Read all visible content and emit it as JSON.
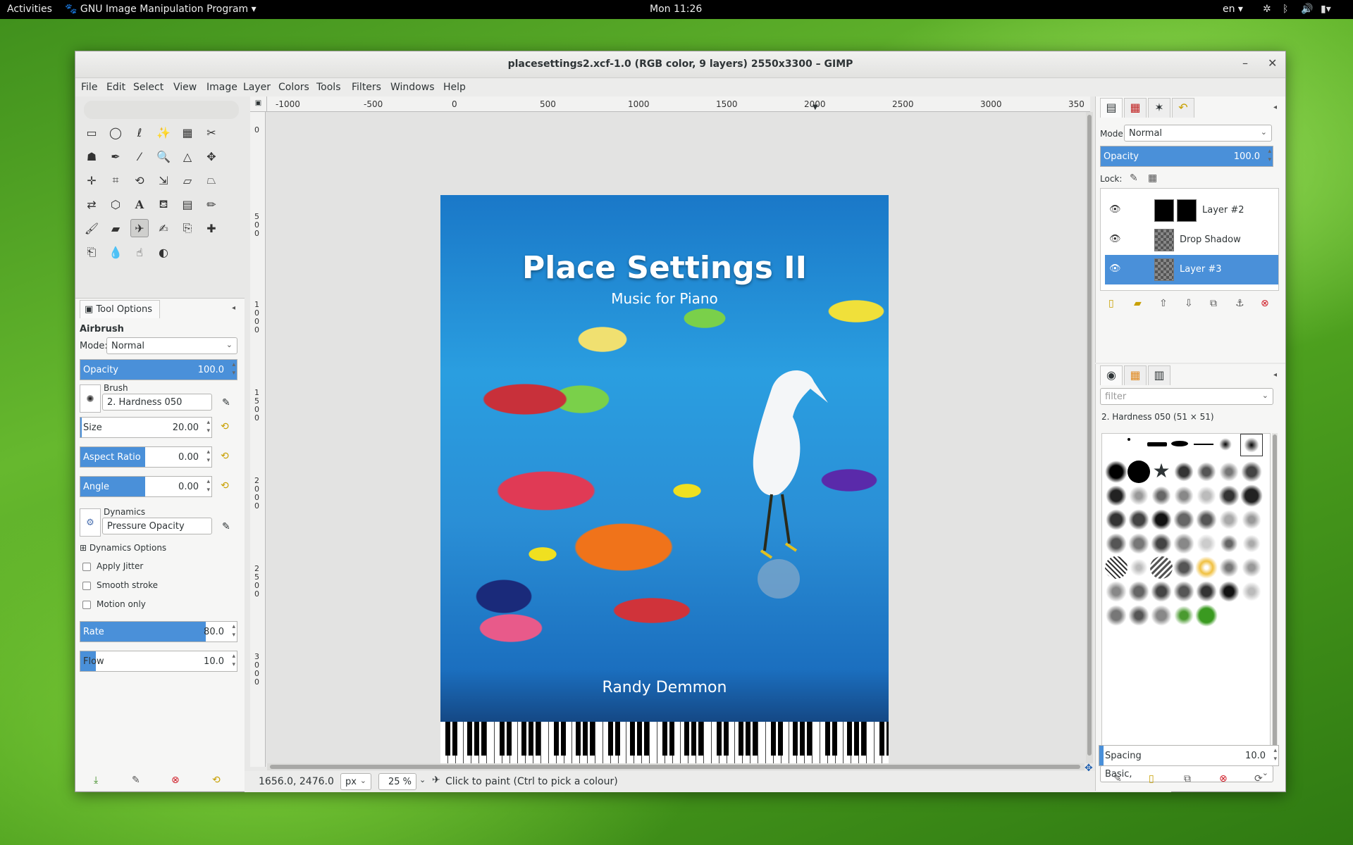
{
  "topbar": {
    "activities": "Activities",
    "app_menu": "GNU Image Manipulation Program ▾",
    "clock": "Mon 11:26",
    "lang": "en ▾"
  },
  "window": {
    "title": "placesettings2.xcf-1.0 (RGB color, 9 layers) 2550x3300 – GIMP",
    "minimize": "–",
    "close": "✕"
  },
  "menu": [
    "File",
    "Edit",
    "Select",
    "View",
    "Image",
    "Layer",
    "Colors",
    "Tools",
    "Filters",
    "Windows",
    "Help"
  ],
  "ruler": {
    "h_ticks": [
      "-1000",
      "-500",
      "0",
      "500",
      "1000",
      "1500",
      "2000",
      "2500",
      "3000",
      "350"
    ],
    "v_ticks": [
      "0",
      "5\n0\n0",
      "1\n0\n0\n0",
      "1\n5\n0\n0",
      "2\n0\n0\n0",
      "2\n5\n0\n0",
      "3\n0\n0\n0"
    ]
  },
  "tool_options": {
    "tab_label": "Tool Options",
    "tool_name": "Airbrush",
    "mode_label": "Mode:",
    "mode_value": "Normal",
    "opacity_label": "Opacity",
    "opacity_value": "100.0",
    "brush_label": "Brush",
    "brush_value": "2. Hardness 050",
    "size_label": "Size",
    "size_value": "20.00",
    "aspect_label": "Aspect Ratio",
    "aspect_value": "0.00",
    "angle_label": "Angle",
    "angle_value": "0.00",
    "dynamics_label": "Dynamics",
    "dynamics_value": "Pressure Opacity",
    "dynamics_options": "Dynamics Options",
    "apply_jitter": "Apply Jitter",
    "smooth_stroke": "Smooth stroke",
    "motion_only": "Motion only",
    "rate_label": "Rate",
    "rate_value": "80.0",
    "flow_label": "Flow",
    "flow_value": "10.0",
    "levels": {
      "opacity": 1.0,
      "rate": 0.8,
      "flow": 0.1
    }
  },
  "artwork": {
    "title": "Place Settings II",
    "subtitle": "Music for Piano",
    "artist": "Randy Demmon"
  },
  "status": {
    "coords": "1656.0, 2476.0",
    "unit": "px",
    "zoom": "25 %",
    "message": "Click to paint (Ctrl to pick a colour)"
  },
  "layers": {
    "mode_label": "Mode:",
    "mode_value": "Normal",
    "opacity_label": "Opacity",
    "opacity_value": "100.0",
    "lock_label": "Lock:",
    "rows": [
      {
        "name": "Layer #2"
      },
      {
        "name": "Drop Shadow"
      },
      {
        "name": "Layer #3"
      }
    ]
  },
  "brushes": {
    "filter_placeholder": "filter",
    "selected_brush": "2. Hardness 050 (51 × 51)",
    "tag_value": "Basic,",
    "spacing_label": "Spacing",
    "spacing_value": "10.0"
  },
  "colors": {
    "accent": "#4a90d9",
    "foreground": "#000000",
    "background": "#ffffff"
  }
}
